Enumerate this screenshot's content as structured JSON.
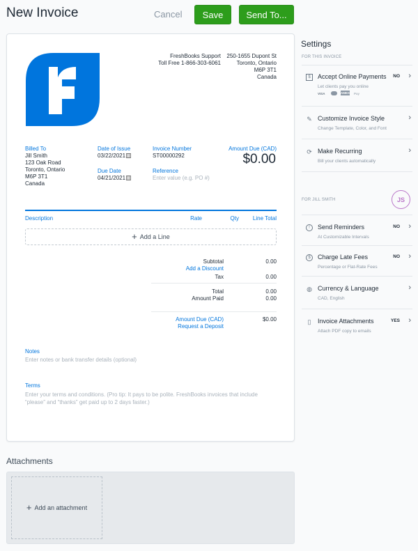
{
  "header": {
    "title": "New Invoice",
    "cancel_label": "Cancel",
    "save_label": "Save",
    "send_label": "Send To..."
  },
  "invoice": {
    "company": {
      "name": "FreshBooks Support",
      "phone": "Toll Free 1-866-303-6061",
      "address": [
        "250-1655 Dupont St",
        "Toronto, Ontario",
        "M6P 3T1",
        "Canada"
      ]
    },
    "billed_to": {
      "label": "Billed To",
      "lines": [
        "Jill Smith",
        "123 Oak Road",
        "Toronto, Ontario",
        "M6P 3T1",
        "Canada"
      ]
    },
    "date_of_issue": {
      "label": "Date of Issue",
      "value": "03/22/2021"
    },
    "due_date": {
      "label": "Due Date",
      "value": "04/21/2021"
    },
    "invoice_number": {
      "label": "Invoice Number",
      "value": "ST00000292"
    },
    "reference": {
      "label": "Reference",
      "placeholder": "Enter value (e.g. PO #)"
    },
    "amount_due": {
      "label": "Amount Due (CAD)",
      "value": "$0.00"
    },
    "columns": [
      "Description",
      "Rate",
      "Qty",
      "Line Total"
    ],
    "add_line_label": "Add a Line",
    "totals": {
      "subtotal_label": "Subtotal",
      "subtotal": "0.00",
      "discount_link": "Add a Discount",
      "tax_label": "Tax",
      "tax": "0.00",
      "total_label": "Total",
      "total": "0.00",
      "paid_label": "Amount Paid",
      "paid": "0.00",
      "due_label": "Amount Due (CAD)",
      "due": "$0.00",
      "deposit_link": "Request a Deposit"
    },
    "notes": {
      "label": "Notes",
      "placeholder": "Enter notes or bank transfer details (optional)"
    },
    "terms": {
      "label": "Terms",
      "placeholder": "Enter your terms and conditions. (Pro tip: It pays to be polite. FreshBooks invoices that include “please” and “thanks” get paid up to 2 days faster.)"
    }
  },
  "settings": {
    "title": "Settings",
    "section_invoice": "FOR THIS INVOICE",
    "section_client": "FOR JILL SMITH",
    "avatar_initials": "JS",
    "payment_methods": [
      "VISA",
      "MC",
      "AMEX",
      "Pay"
    ],
    "items": [
      {
        "name": "Accept Online Payments",
        "sub": "Let clients pay you online",
        "status": "NO",
        "icon": "payment-icon"
      },
      {
        "name": "Customize Invoice Style",
        "sub": "Change Template, Color, and Font",
        "status": "",
        "icon": "brush-icon"
      },
      {
        "name": "Make Recurring",
        "sub": "Bill your clients automatically",
        "status": "",
        "icon": "recurring-icon"
      },
      {
        "name": "Send Reminders",
        "sub": "At Customizable Intervals",
        "status": "NO",
        "icon": "alarm-icon"
      },
      {
        "name": "Charge Late Fees",
        "sub": "Percentage or Flat-Rate Fees",
        "status": "NO",
        "icon": "late-fee-icon"
      },
      {
        "name": "Currency & Language",
        "sub": "CAD, English",
        "status": "",
        "icon": "globe-icon"
      },
      {
        "name": "Invoice Attachments",
        "sub": "Attach PDF copy to emails",
        "status": "YES",
        "icon": "attachment-icon"
      }
    ]
  },
  "attachments": {
    "title": "Attachments",
    "add_label": "Add an attachment"
  }
}
